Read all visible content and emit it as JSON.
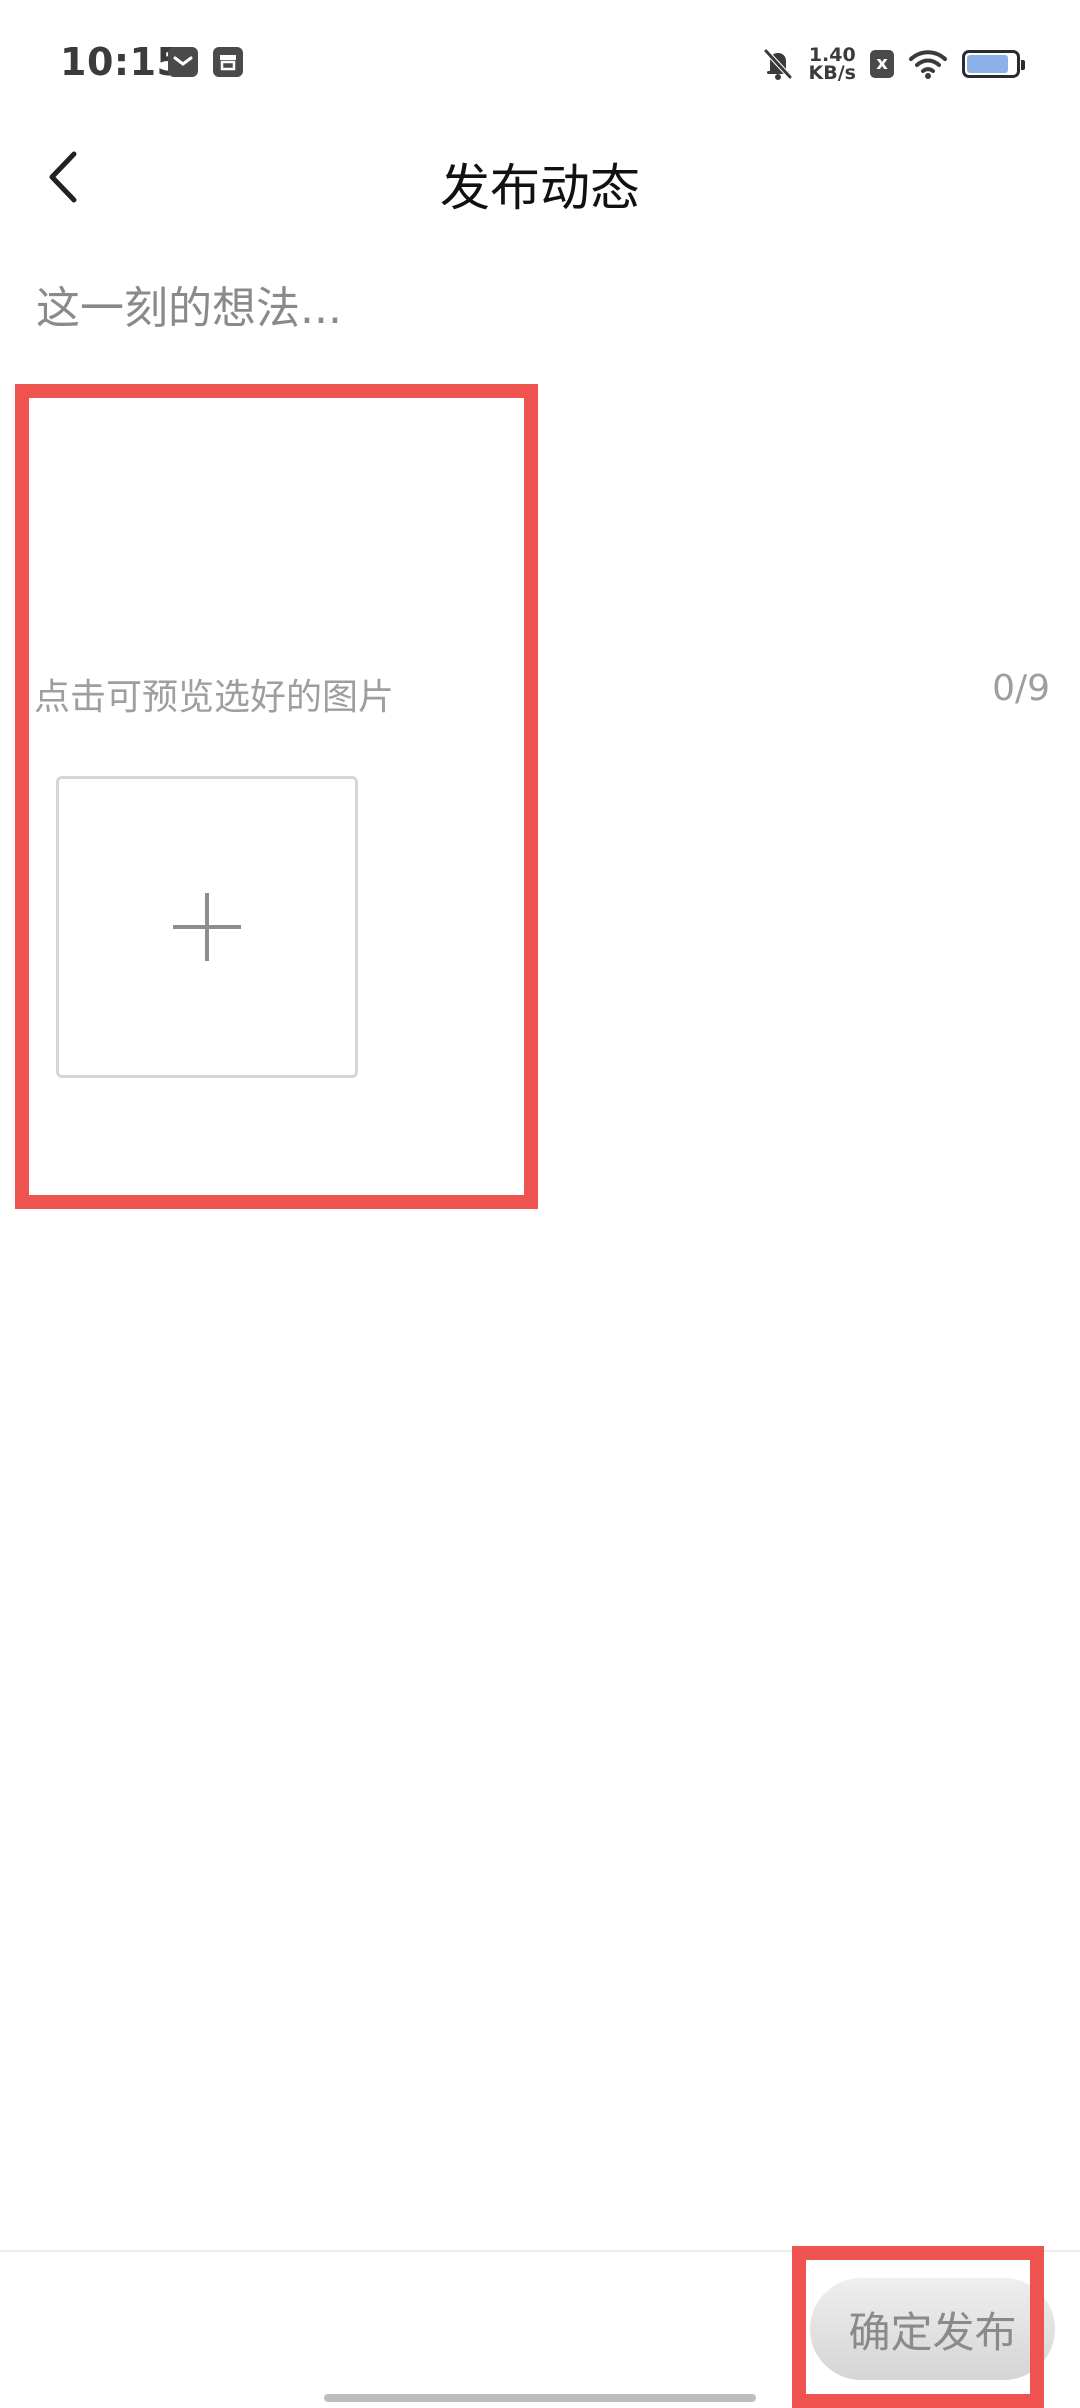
{
  "status_bar": {
    "time": "10:15",
    "net_speed_value": "1.40",
    "net_speed_unit": "KB/s",
    "badge_text": "x",
    "battery_level": 0.85,
    "icons": [
      "mail-icon",
      "archive-icon",
      "mute-bell-icon",
      "wifi-icon",
      "battery-icon"
    ]
  },
  "header": {
    "title": "发布动态",
    "back_icon": "chevron-left-icon"
  },
  "editor": {
    "placeholder": "这一刻的想法..."
  },
  "images": {
    "hint": "点击可预览选好的图片",
    "counter": "0/9",
    "add_icon": "plus-icon"
  },
  "footer": {
    "submit_label": "确定发布"
  },
  "colors": {
    "annotation_red": "#ef5350",
    "hint_gray": "#9e9e9e",
    "battery_fill": "#8eb0e8"
  }
}
